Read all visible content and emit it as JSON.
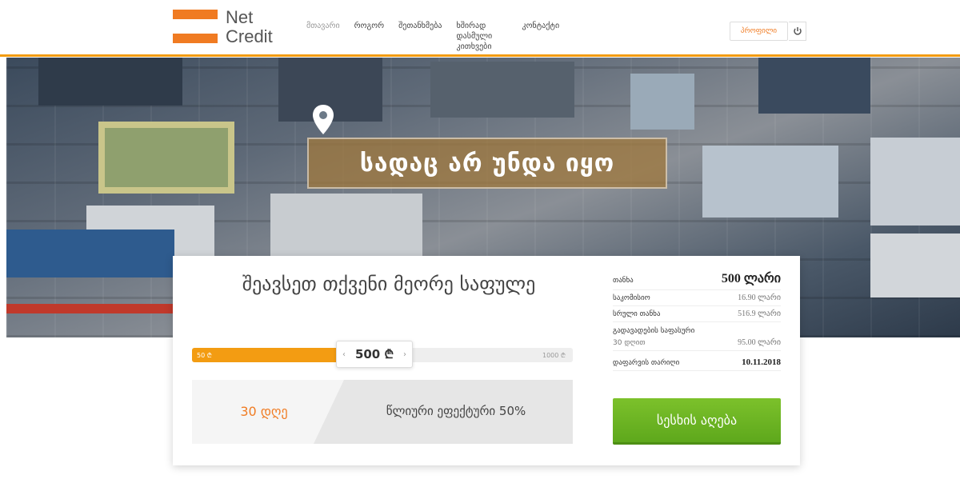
{
  "brand": {
    "line1": "Net",
    "line2": "Credit",
    "accent": "#f07b22"
  },
  "nav": {
    "items": [
      {
        "label": "მთავარი"
      },
      {
        "label": "როგორ"
      },
      {
        "label": "შეთანხმება"
      },
      {
        "label": "ხშირად დასმული კითხვები"
      },
      {
        "label": "კონტაქტი"
      }
    ]
  },
  "header": {
    "login_label": "პროფილი",
    "power_icon": "power-icon"
  },
  "hero": {
    "title": "სადაც არ უნდა იყო",
    "pin_icon": "location-pin-icon"
  },
  "calculator": {
    "heading": "შეავსეთ თქვენი მეორე საფულე",
    "slider": {
      "min_label": "50 ₾",
      "max_label": "1000 ₾",
      "value": "500 ₾",
      "min": 50,
      "max": 1000,
      "current": 500
    },
    "term_days": "30 დღე",
    "annual_rate": "წლიური ეფექტური 50%"
  },
  "summary": {
    "amount_label": "თანხა",
    "amount_value": "500 ლარი",
    "fee_label": "საკომისიო",
    "fee_value": "16.90 ლარი",
    "total_label": "სრული თანხა",
    "total_value": "516.9 ლარი",
    "schedule_label": "გადავადების საფასური",
    "schedule_days": "30 დღით",
    "schedule_value": "95.00 ლარი",
    "due_label": "დაფარვის თარიღი",
    "due_value": "10.11.2018",
    "cta_label": "სესხის აღება",
    "cta_color": "#6cb523"
  }
}
